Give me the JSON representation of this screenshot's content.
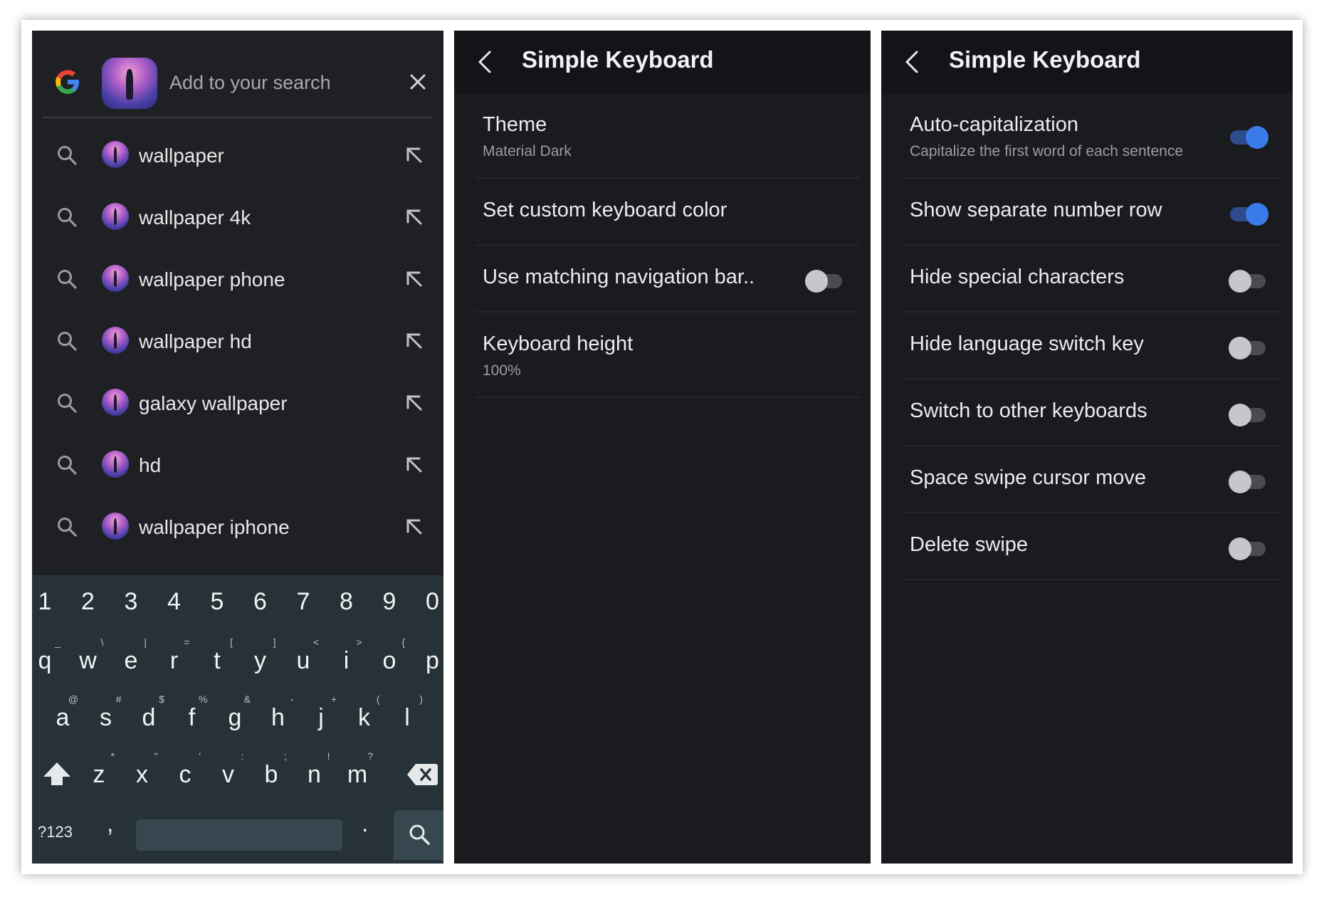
{
  "search_panel": {
    "placeholder": "Add to your search",
    "suggestions": [
      {
        "text": "wallpaper"
      },
      {
        "text": "wallpaper 4k"
      },
      {
        "text": "wallpaper phone"
      },
      {
        "text": "wallpaper hd"
      },
      {
        "text": "galaxy wallpaper"
      },
      {
        "text": "hd"
      },
      {
        "text": "wallpaper iphone"
      }
    ],
    "keyboard": {
      "row_numbers": [
        "1",
        "2",
        "3",
        "4",
        "5",
        "6",
        "7",
        "8",
        "9",
        "0"
      ],
      "row_q": [
        {
          "k": "q",
          "h": "_"
        },
        {
          "k": "w",
          "h": "\\"
        },
        {
          "k": "e",
          "h": "|"
        },
        {
          "k": "r",
          "h": "="
        },
        {
          "k": "t",
          "h": "["
        },
        {
          "k": "y",
          "h": "]"
        },
        {
          "k": "u",
          "h": "<"
        },
        {
          "k": "i",
          "h": ">"
        },
        {
          "k": "o",
          "h": "{"
        },
        {
          "k": "p",
          "h": ""
        }
      ],
      "row_a": [
        {
          "k": "a",
          "h": "@"
        },
        {
          "k": "s",
          "h": "#"
        },
        {
          "k": "d",
          "h": "$"
        },
        {
          "k": "f",
          "h": "%"
        },
        {
          "k": "g",
          "h": "&"
        },
        {
          "k": "h",
          "h": "-"
        },
        {
          "k": "j",
          "h": "+"
        },
        {
          "k": "k",
          "h": "("
        },
        {
          "k": "l",
          "h": ")"
        }
      ],
      "row_z": [
        {
          "k": "z",
          "h": "*"
        },
        {
          "k": "x",
          "h": "\""
        },
        {
          "k": "c",
          "h": "'"
        },
        {
          "k": "v",
          "h": ":"
        },
        {
          "k": "b",
          "h": ";"
        },
        {
          "k": "n",
          "h": "!"
        },
        {
          "k": "m",
          "h": "?"
        }
      ],
      "symbols_label": "?123",
      "comma": ",",
      "period": "."
    }
  },
  "panel2": {
    "title": "Simple Keyboard",
    "items": [
      {
        "label": "Theme",
        "sub": "Material Dark"
      },
      {
        "label": "Set custom keyboard color"
      },
      {
        "label": "Use matching navigation bar..",
        "toggle": false
      },
      {
        "label": "Keyboard height",
        "sub": "100%"
      }
    ]
  },
  "panel3": {
    "title": "Simple Keyboard",
    "items": [
      {
        "label": "Auto-capitalization",
        "sub": "Capitalize the first word of each sentence",
        "toggle": true
      },
      {
        "label": "Show separate number row",
        "toggle": true
      },
      {
        "label": "Hide special characters",
        "toggle": false
      },
      {
        "label": "Hide language switch key",
        "toggle": false
      },
      {
        "label": "Switch to other keyboards",
        "toggle": false
      },
      {
        "label": "Space swipe cursor move",
        "toggle": false
      },
      {
        "label": "Delete swipe",
        "toggle": false
      }
    ]
  },
  "colors": {
    "accent": "#3a7bea",
    "panel_bg": "#1a1b1f",
    "keyboard_bg": "#263238"
  }
}
